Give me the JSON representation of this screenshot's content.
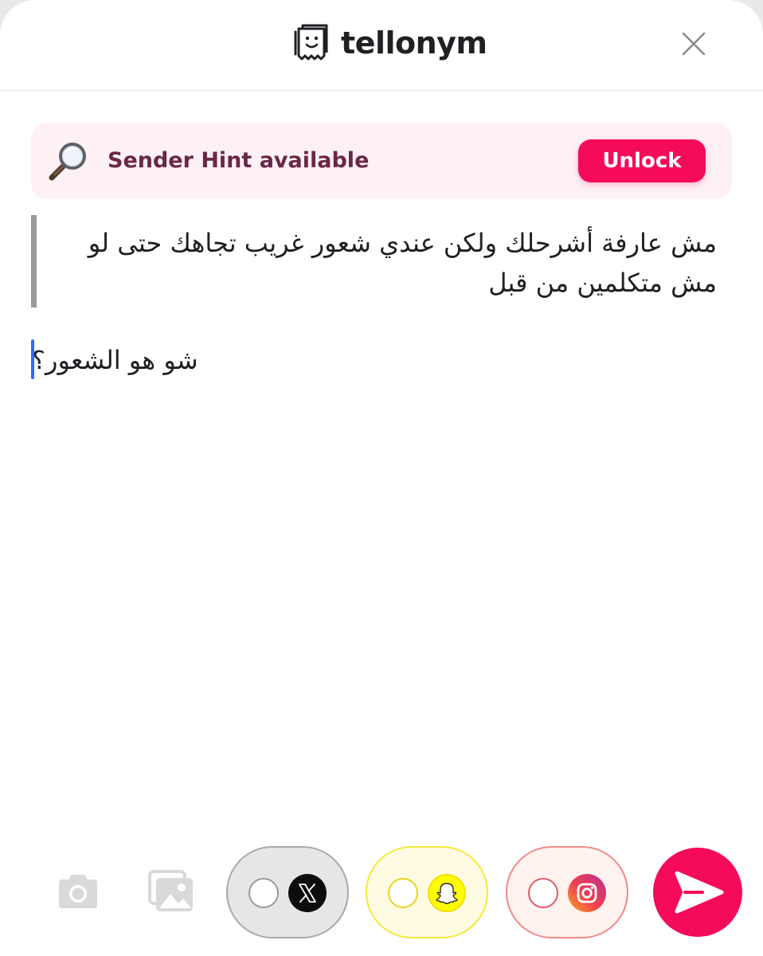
{
  "header": {
    "brand_name": "tellonym",
    "logo_icon": "tellonym-logo-icon",
    "close_icon": "close-icon"
  },
  "hint_banner": {
    "icon": "magnifier-icon",
    "text": "Sender Hint available",
    "unlock_label": "Unlock"
  },
  "message": {
    "text": "مش عارفة أشرحلك ولكن عندي شعور غريب تجاهك حتى لو مش متكلمين من قبل"
  },
  "answer": {
    "value": "شو هو الشعور؟"
  },
  "toolbar": {
    "camera_icon": "camera-icon",
    "gallery_icon": "gallery-icon",
    "share_toggles": [
      {
        "network": "X",
        "icon": "x-logo-icon",
        "on": false
      },
      {
        "network": "Snapchat",
        "icon": "snapchat-ghost-icon",
        "on": false
      },
      {
        "network": "Instagram",
        "icon": "instagram-logo-icon",
        "on": false
      }
    ],
    "send_icon": "send-arrow-icon"
  },
  "colors": {
    "accent": "#f50a5c",
    "hint_background": "#fdf1f5",
    "hint_text": "#6b2746",
    "caret": "#2f6bff"
  }
}
